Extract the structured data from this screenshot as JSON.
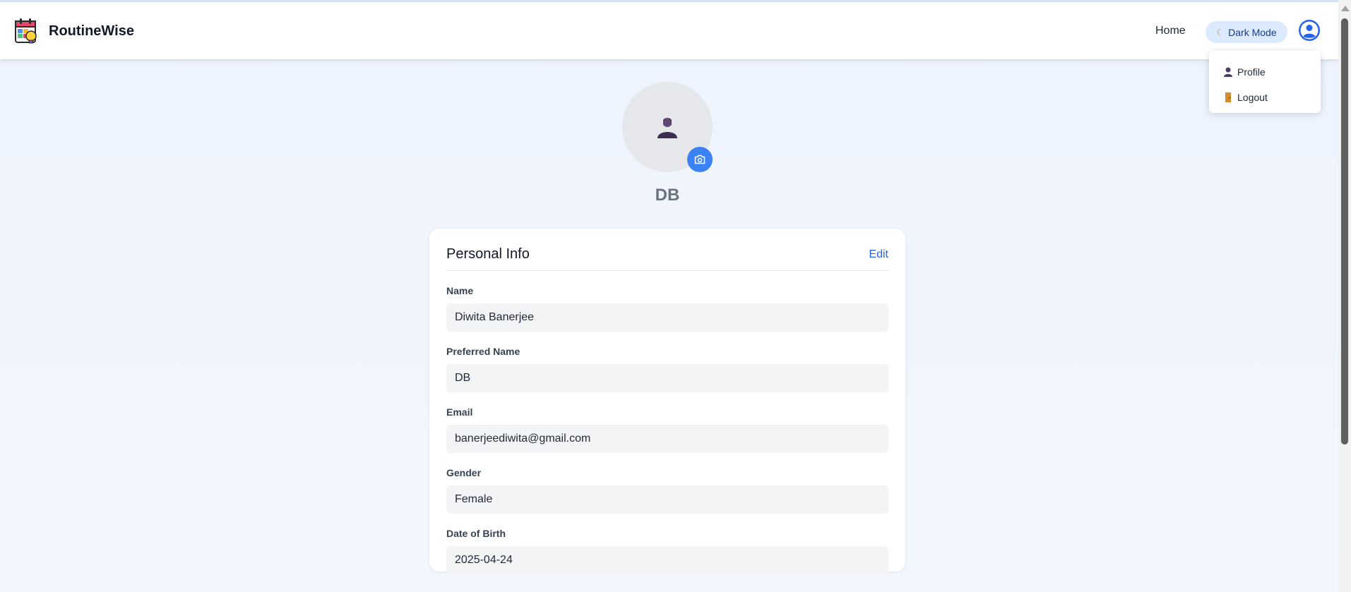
{
  "app": {
    "name": "RoutineWise",
    "logo_icon": "calendar-bulb-logo"
  },
  "nav": {
    "home_label": "Home",
    "dark_mode_label": "Dark Mode",
    "dark_mode_icon": "moon-icon",
    "user_icon": "user-circle-icon"
  },
  "dropdown": {
    "items": [
      {
        "label": "Profile",
        "icon": "person-icon"
      },
      {
        "label": "Logout",
        "icon": "door-icon"
      }
    ]
  },
  "profile": {
    "avatar_icon": "person-silhouette-icon",
    "camera_icon": "camera-icon",
    "display_name": "DB"
  },
  "card": {
    "title": "Personal Info",
    "edit_label": "Edit",
    "fields": [
      {
        "label": "Name",
        "value": "Diwita Banerjee"
      },
      {
        "label": "Preferred Name",
        "value": "DB"
      },
      {
        "label": "Email",
        "value": "banerjeediwita@gmail.com"
      },
      {
        "label": "Gender",
        "value": "Female"
      },
      {
        "label": "Date of Birth",
        "value": "2025-04-24"
      }
    ]
  },
  "colors": {
    "accent": "#3b82f6",
    "link": "#2563eb",
    "toggle_bg": "#dbeafe",
    "avatar_bg": "#e5e7eb",
    "field_bg": "#f3f4f6"
  }
}
